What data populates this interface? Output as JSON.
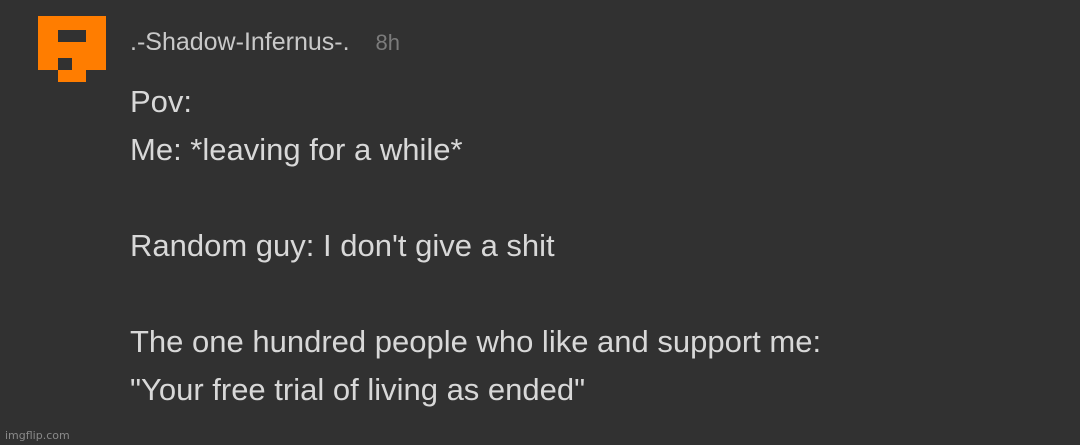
{
  "comment": {
    "avatar_icon": "pixel-face-icon",
    "avatar_color": "#ff7d00",
    "username": ".-Shadow-Infernus-.",
    "timestamp": "8h",
    "lines": [
      "Pov:",
      "Me: *leaving for a while*",
      "",
      "Random guy: I don't give a shit",
      "",
      "The one hundred people who like and support me:",
      "\"Your free trial of living as ended\""
    ]
  },
  "watermark": "imgflip.com",
  "colors": {
    "background": "#313131",
    "username": "#c9c9c9",
    "timestamp": "#7b7b7b",
    "body_text": "#d8d8d8"
  }
}
